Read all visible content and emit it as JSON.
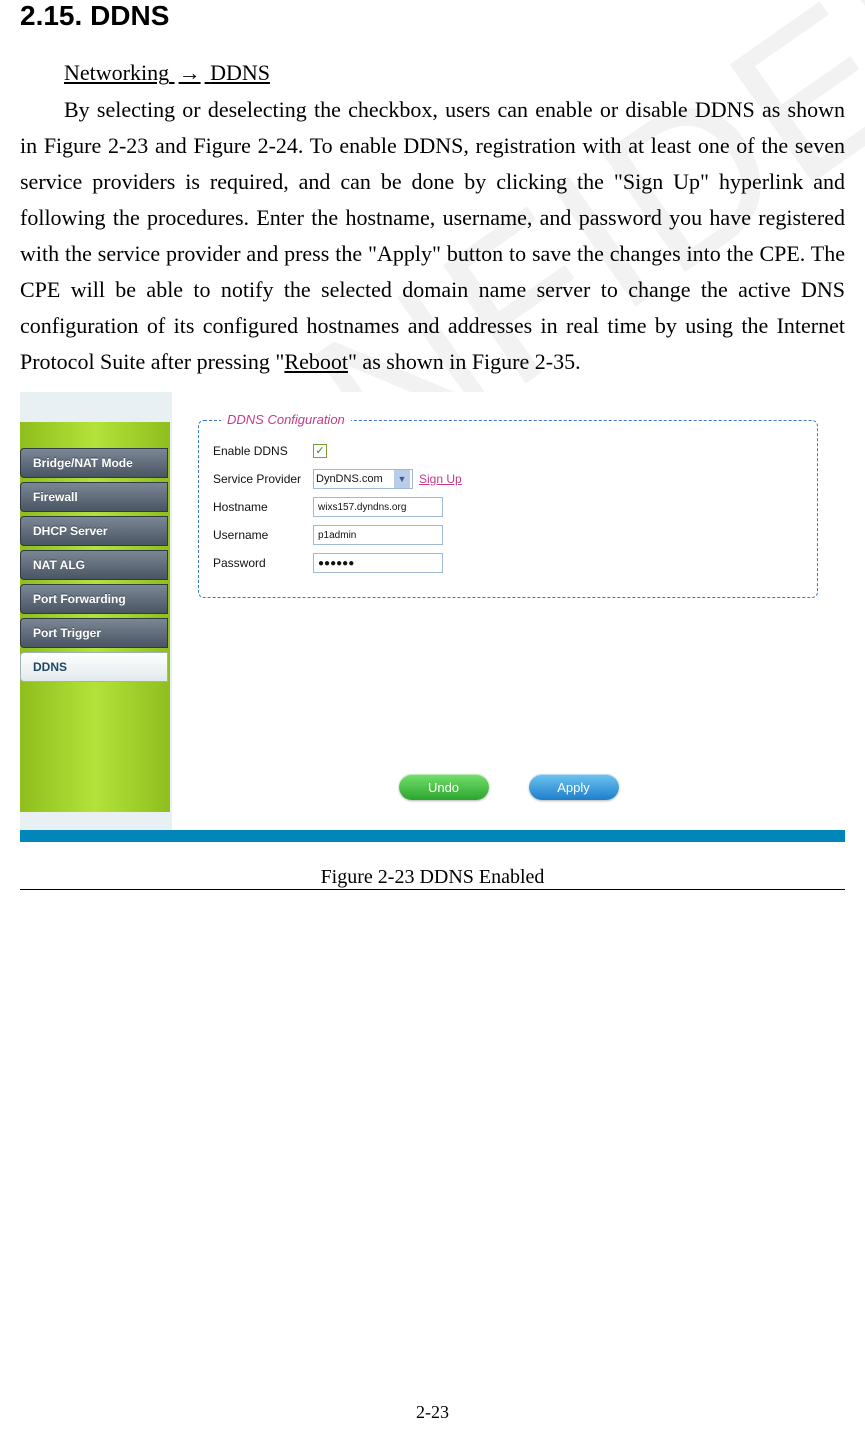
{
  "watermark_text": "CONFIDENTIAL",
  "section": {
    "number": "2.15.",
    "title": "DDNS"
  },
  "breadcrumb": {
    "part1": "Networking",
    "arrow": "→",
    "part2": "DDNS"
  },
  "paragraph": {
    "p1": "By selecting or deselecting the checkbox, users can enable or disable DDNS as shown in Figure 2-23 and Figure 2-24. To enable DDNS, registration with at least one of the seven service providers is required, and can be done by clicking the \"Sign Up\" hyperlink and following the procedures. Enter the hostname, username, and password you have registered with the service provider and press the \"Apply\" button to save the changes into the CPE. The CPE will be able to notify the selected domain name server to change the active DNS configuration of its configured hostnames and addresses in real time by using the Internet Protocol Suite after pressing \"",
    "reboot": "Reboot",
    "p2": "\" as shown in Figure 2-35."
  },
  "screenshot": {
    "nav": [
      "Bridge/NAT Mode",
      "Firewall",
      "DHCP Server",
      "NAT ALG",
      "Port Forwarding",
      "Port Trigger",
      "DDNS"
    ],
    "panel_title": "DDNS Configuration",
    "rows": {
      "enable_label": "Enable DDNS",
      "enable_checked": "✓",
      "provider_label": "Service Provider",
      "provider_value": "DynDNS.com",
      "signup": "Sign Up",
      "hostname_label": "Hostname",
      "hostname_value": "wixs157.dyndns.org",
      "username_label": "Username",
      "username_value": "p1admin",
      "password_label": "Password",
      "password_value": "●●●●●●"
    },
    "buttons": {
      "undo": "Undo",
      "apply": "Apply"
    }
  },
  "figure_caption": "Figure 2-23    DDNS Enabled",
  "page_number": "2-23"
}
